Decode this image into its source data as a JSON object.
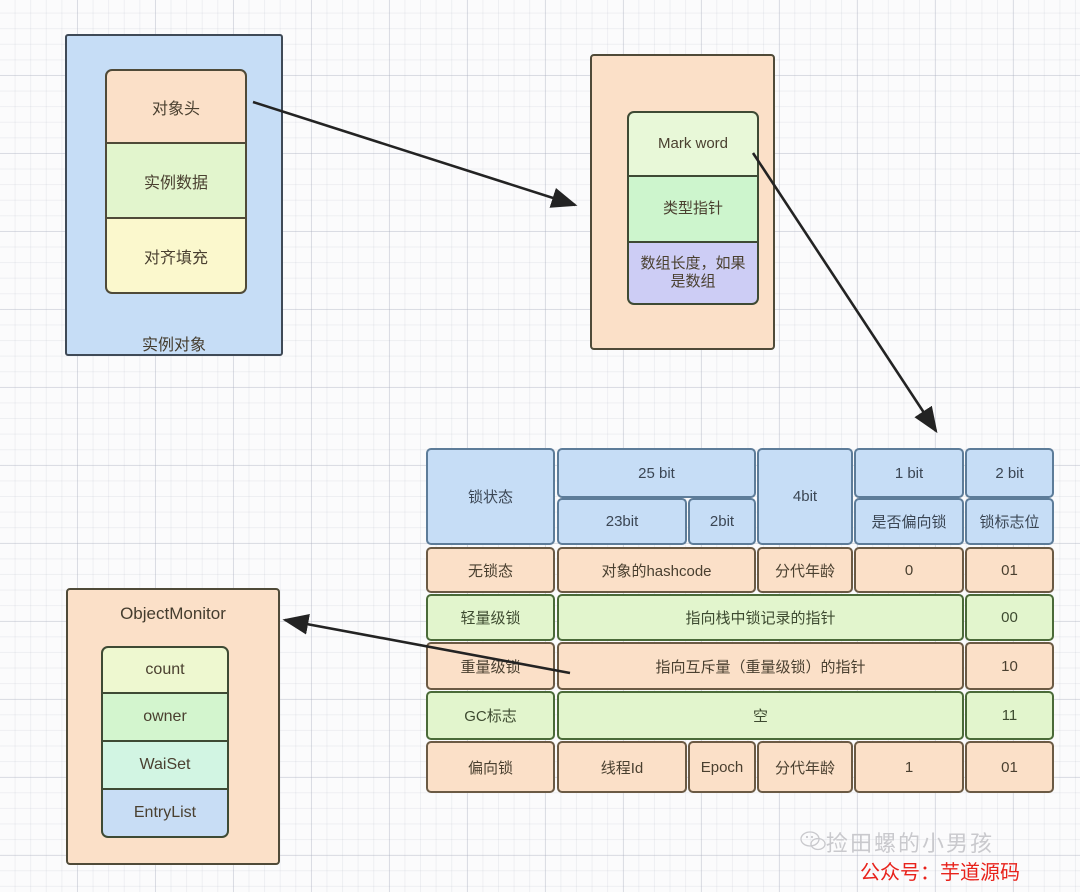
{
  "instance_object": {
    "caption": "实例对象",
    "segments": [
      {
        "label": "对象头",
        "color": "#fbe0c8"
      },
      {
        "label": "实例数据",
        "color": "#e2f5cd"
      },
      {
        "label": "对齐填充",
        "color": "#fbf8cd"
      }
    ]
  },
  "object_header": {
    "segments": [
      {
        "label": "Mark word",
        "color": "#e8f8d8"
      },
      {
        "label": "类型指针",
        "color": "#cdf5cd"
      },
      {
        "label": "数组长度，如果是数组",
        "color": "#cdcdf5"
      }
    ]
  },
  "object_monitor": {
    "title": "ObjectMonitor",
    "segments": [
      {
        "label": "count",
        "color": "#eef8d0"
      },
      {
        "label": "owner",
        "color": "#d3f5ce"
      },
      {
        "label": "WaiSet",
        "color": "#d2f5e3"
      },
      {
        "label": "EntryList",
        "color": "#c8ddf5"
      }
    ]
  },
  "lock_table": {
    "header": {
      "state_label": "锁状态",
      "span_25bit": "25 bit",
      "sub_23bit": "23bit",
      "sub_2bit": "2bit",
      "col_4bit": "4bit",
      "col_1bit_top": "1 bit",
      "col_1bit_bottom": "是否偏向锁",
      "col_2bit_top": "2 bit",
      "col_2bit_bottom": "锁标志位"
    },
    "rows": [
      {
        "state": "无锁态",
        "style": "peach",
        "cells": [
          "对象的hashcode",
          "分代年龄",
          "0",
          "01"
        ]
      },
      {
        "state": "轻量级锁",
        "style": "green",
        "cells": [
          "指向栈中锁记录的指针",
          "00"
        ]
      },
      {
        "state": "重量级锁",
        "style": "peach",
        "cells": [
          "指向互斥量（重量级锁）的指针",
          "10"
        ]
      },
      {
        "state": "GC标志",
        "style": "green",
        "cells": [
          "空",
          "11"
        ]
      },
      {
        "state": "偏向锁",
        "style": "peach",
        "cells": [
          "线程Id",
          "Epoch",
          "分代年龄",
          "1",
          "01"
        ]
      }
    ]
  },
  "watermark": {
    "account_name": "捡田螺的小男孩",
    "public_account": "公众号：芋道源码"
  },
  "colors": {
    "blue_fill": "#c6ddf6",
    "peach_fill": "#fbe0c8",
    "green_fill": "#e2f5cd",
    "yellow_fill": "#fbf8cd",
    "purple_fill": "#cdcdf5",
    "arrow": "#232323",
    "watermark_red": "#e8221b"
  }
}
